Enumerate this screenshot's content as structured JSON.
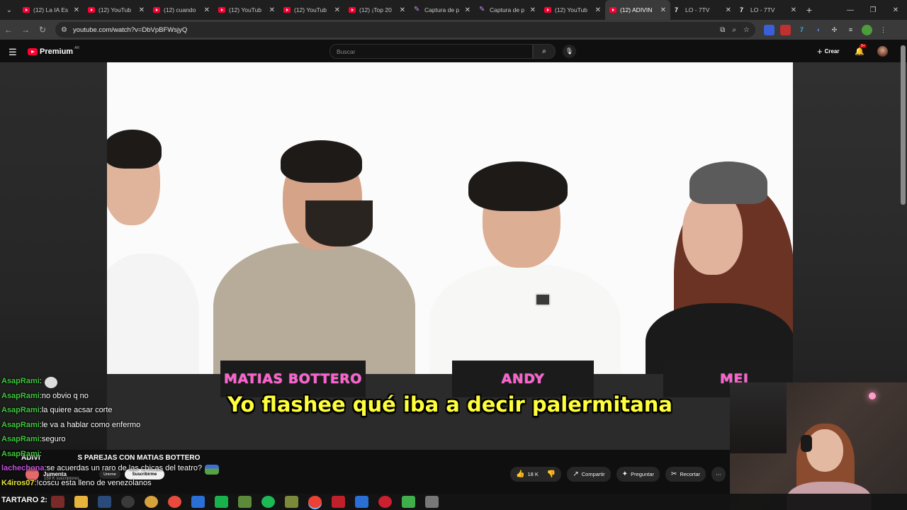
{
  "browser": {
    "tabs": [
      {
        "label": "(12) La IA Es",
        "icon": "youtube-icon",
        "active": false
      },
      {
        "label": "(12) YouTub",
        "icon": "youtube-icon",
        "active": false
      },
      {
        "label": "(12) cuando",
        "icon": "youtube-icon",
        "active": false
      },
      {
        "label": "(12) YouTub",
        "icon": "youtube-icon",
        "active": false
      },
      {
        "label": "(12) YouTub",
        "icon": "youtube-icon",
        "active": false
      },
      {
        "label": "(12) ¡Top 20",
        "icon": "youtube-icon",
        "active": false
      },
      {
        "label": "Captura de p",
        "icon": "pen-icon",
        "active": false
      },
      {
        "label": "Captura de p",
        "icon": "pen-icon",
        "active": false
      },
      {
        "label": "(12) YouTub",
        "icon": "youtube-icon",
        "active": false
      },
      {
        "label": "(12) ADIVIN",
        "icon": "youtube-icon",
        "active": true
      },
      {
        "label": "LO - 7TV",
        "icon": "seventv-icon",
        "active": false
      },
      {
        "label": "LO - 7TV",
        "icon": "seventv-icon",
        "active": false
      }
    ],
    "url": "youtube.com/watch?v=DbVpBFWsjyQ"
  },
  "youtube": {
    "logo_label": "Premium",
    "logo_country": "AR",
    "search_placeholder": "Buscar",
    "create_label": "Crear",
    "notif_count": "9+"
  },
  "video": {
    "caption": "Yo flashee qué iba a decir palermitana",
    "nameplates": [
      "MATIAS BOTTERO",
      "ANDY",
      "MEI"
    ],
    "title": "S PAREJAS CON MATIAS BOTTERO",
    "title_prefix": "ADIVI",
    "channel_name": "Jumenta",
    "subscribers": "159 K suscriptores",
    "join_label": "Unirme",
    "subscribe_label": "Suscribirme",
    "likes": "18 K",
    "share_label": "Compartir",
    "ask_label": "Preguntar",
    "clip_label": "Recortar"
  },
  "chat": [
    {
      "user": "AsapRami",
      "color": "#3fc73f",
      "text": "",
      "emote": "face-emote"
    },
    {
      "user": "AsapRami",
      "color": "#3fc73f",
      "text": "no obvio q no"
    },
    {
      "user": "AsapRami",
      "color": "#3fc73f",
      "text": "la quiere acsar corte"
    },
    {
      "user": "AsapRami",
      "color": "#3fc73f",
      "text": "le va a hablar como enfermo"
    },
    {
      "user": "AsapRami",
      "color": "#3fc73f",
      "text": "seguro"
    },
    {
      "user": "AsapRami",
      "color": "#3fc73f",
      "text": ""
    },
    {
      "user": "lachechona",
      "color": "#c04fe0",
      "text": "se acuerdas un raro de las chicas del teatro?",
      "emote": "pepe-emote"
    },
    {
      "user": "K4iros07",
      "color": "#e6e63c",
      "text": "!coscu esta lleno de venezolanos"
    }
  ],
  "taskbar": {
    "overlay_text": "TARTARO 2:",
    "icons": [
      "terminal-icon",
      "file-explorer-icon",
      "steam-icon",
      "obs-icon",
      "chrome-canary-icon",
      "chrome-icon",
      "ccleaner-icon",
      "greenapp-icon",
      "minecraft-icon",
      "spotify-icon",
      "discord-icon",
      "chrome-active-icon",
      "recorder-icon",
      "ccleaner2-icon",
      "opera-icon",
      "minecraft2-icon",
      "app-icon"
    ]
  },
  "colors": {
    "caption": "#ffff3a",
    "nameplate": "#ff5fd0",
    "yt_red": "#ff0033"
  }
}
